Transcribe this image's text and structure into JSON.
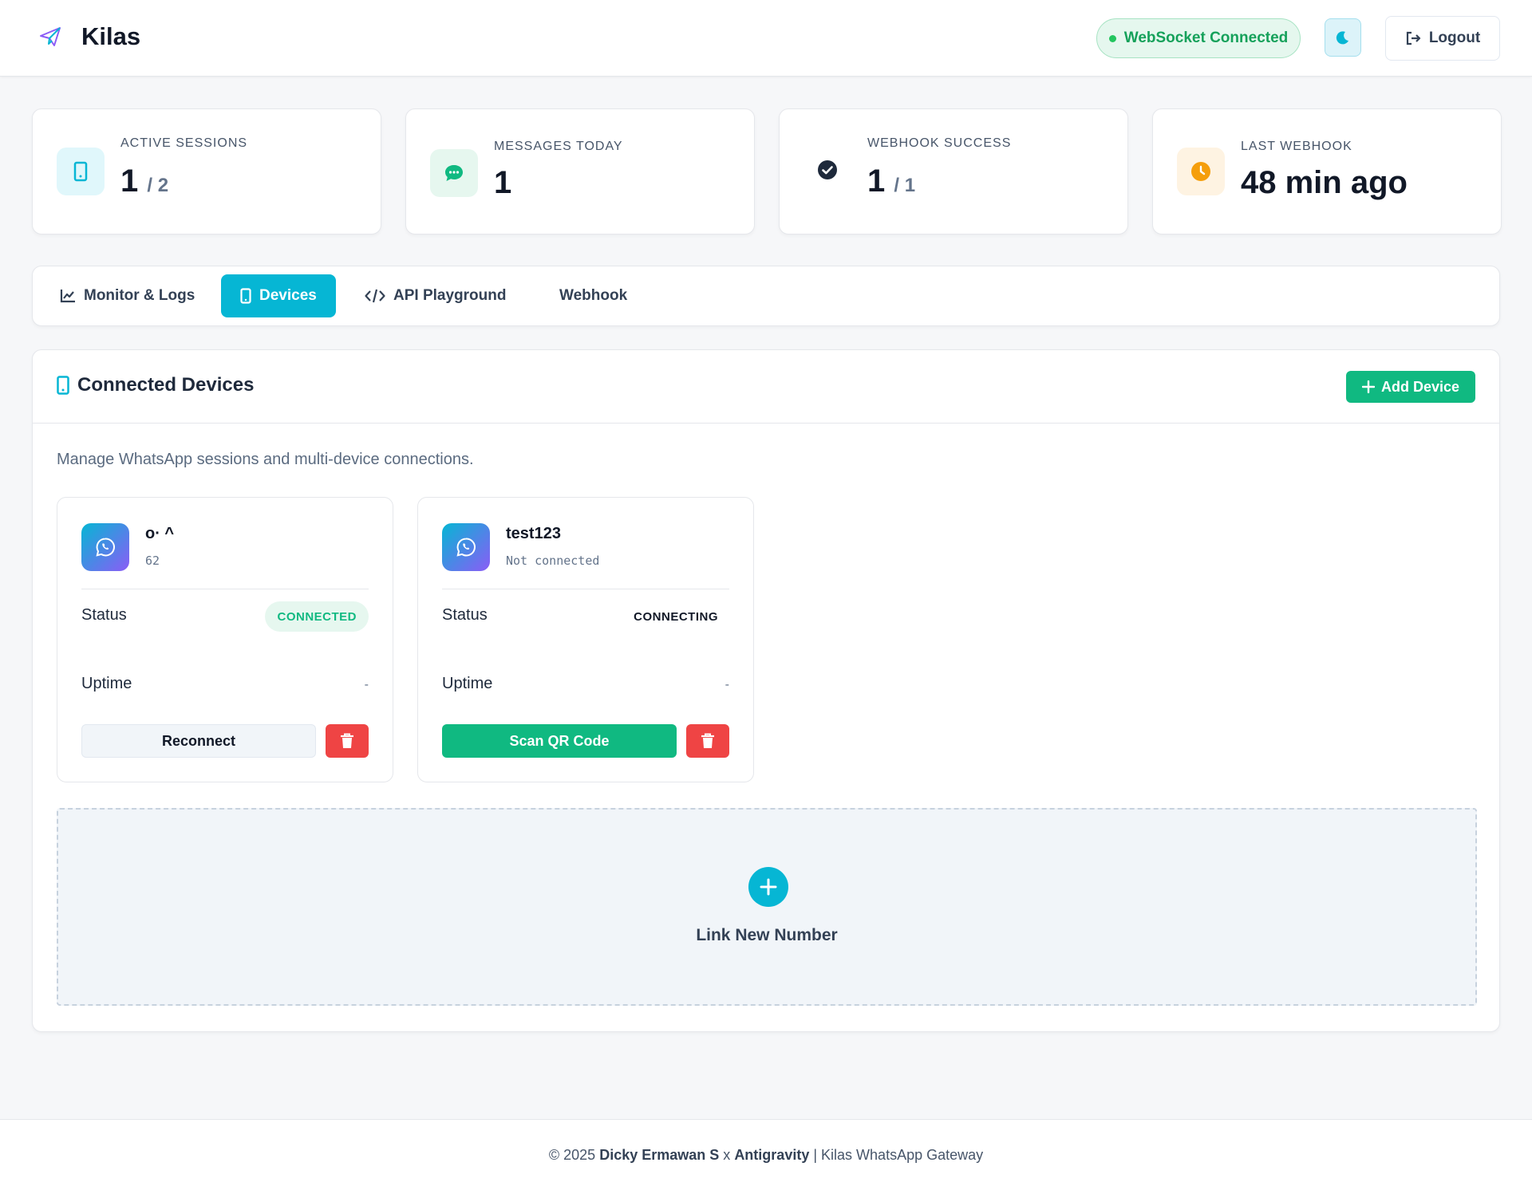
{
  "header": {
    "brand": "Kilas",
    "ws_status": "WebSocket Connected",
    "logout_label": "Logout"
  },
  "stats": [
    {
      "label": "ACTIVE SESSIONS",
      "value": "1",
      "sub": "/ 2",
      "icon": "phone-icon",
      "color": "#06b6d4"
    },
    {
      "label": "MESSAGES TODAY",
      "value": "1",
      "sub": "",
      "icon": "chat-icon",
      "color": "#10b981"
    },
    {
      "label": "WEBHOOK SUCCESS",
      "value": "1",
      "sub": "/ 1",
      "icon": "check-circle-icon",
      "color": "#1e293b"
    },
    {
      "label": "LAST WEBHOOK",
      "value": "48 min ago",
      "sub": "",
      "icon": "clock-icon",
      "color": "#f59e0b"
    }
  ],
  "tabs": [
    {
      "label": "Monitor & Logs",
      "icon": "chart-line-icon"
    },
    {
      "label": "Devices",
      "icon": "phone-icon",
      "active": true
    },
    {
      "label": "API Playground",
      "icon": "code-icon"
    },
    {
      "label": "Webhook",
      "icon": ""
    }
  ],
  "panel": {
    "title": "Connected Devices",
    "add_button": "Add Device",
    "description": "Manage WhatsApp sessions and multi-device connections."
  },
  "devices": [
    {
      "name": "o· ^",
      "sub": "62",
      "status_label": "Status",
      "status": "CONNECTED",
      "uptime_label": "Uptime",
      "uptime": "-",
      "action": "Reconnect"
    },
    {
      "name": "test123",
      "sub": "Not connected",
      "status_label": "Status",
      "status": "CONNECTING",
      "uptime_label": "Uptime",
      "uptime": "-",
      "action": "Scan QR Code"
    }
  ],
  "link_new": "Link New Number",
  "footer": {
    "prefix": "© 2025",
    "author": "Dicky Ermawan S",
    "x": "x",
    "partner": "Antigravity",
    "suffix": "| Kilas WhatsApp Gateway"
  },
  "colors": {
    "accent": "#06b6d4",
    "success": "#10b981",
    "danger": "#ef4444"
  }
}
